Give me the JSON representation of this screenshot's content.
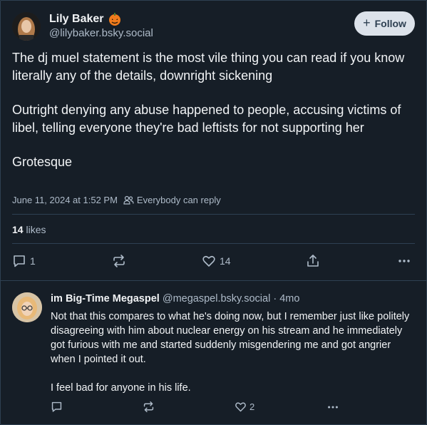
{
  "post": {
    "display_name": "Lily Baker",
    "name_emoji_icon": "pumpkin-icon",
    "handle": "@lilybaker.bsky.social",
    "follow_label": "Follow",
    "paragraphs": [
      "The dj muel statement is the most vile thing you can read if you know literally any of the details, downright sickening",
      "Outright denying any abuse happened to people, accusing victims of libel, telling everyone they're bad leftists for not supporting her",
      "Grotesque"
    ],
    "timestamp": "June 11, 2024 at 1:52 PM",
    "reply_setting": "Everybody can reply",
    "like_count": "14",
    "likes_word": "likes",
    "actions": {
      "reply_count": "1",
      "like_count": "14"
    }
  },
  "reply": {
    "display_name": "im Big-Time Megaspel",
    "handle_time": "@megaspel.bsky.social · 4mo",
    "paragraphs": [
      "Not that this compares to what he's doing now, but I remember just like politely disagreeing with him about nuclear energy on his stream and he immediately got furious with me and started suddenly misgendering me and got angrier when I pointed it out.",
      "I feel bad for anyone in his life."
    ],
    "actions": {
      "like_count": "2"
    }
  }
}
